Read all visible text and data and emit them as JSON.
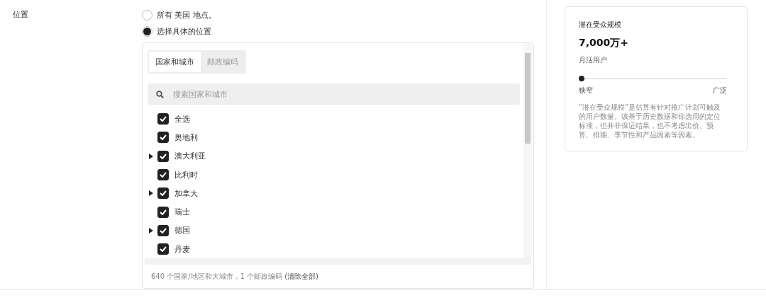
{
  "field_label": "位置",
  "options": [
    {
      "label": "所有 美国 地点。",
      "selected": false
    },
    {
      "label": "选择具体的位置",
      "selected": true
    }
  ],
  "tabs": [
    {
      "label": "国家和城市",
      "selected": true
    },
    {
      "label": "邮政编码",
      "selected": false
    }
  ],
  "search": {
    "placeholder": "搜索国家和城市"
  },
  "items": [
    {
      "label": "全选",
      "checked": true,
      "expandable": false
    },
    {
      "label": "奥地利",
      "checked": true,
      "expandable": false
    },
    {
      "label": "澳大利亚",
      "checked": true,
      "expandable": true
    },
    {
      "label": "比利时",
      "checked": true,
      "expandable": false
    },
    {
      "label": "加拿大",
      "checked": true,
      "expandable": true
    },
    {
      "label": "瑞士",
      "checked": true,
      "expandable": false
    },
    {
      "label": "德国",
      "checked": true,
      "expandable": true
    },
    {
      "label": "丹麦",
      "checked": true,
      "expandable": false
    }
  ],
  "summary": {
    "text": "640 个国家/地区和大城市，1 个邮政编码",
    "link": "(清除全部)"
  },
  "audience": {
    "title": "潜在受众规模",
    "value": "7,000万+",
    "unit": "月活用户",
    "level": 0,
    "min_label": "狭窄",
    "max_label": "广泛",
    "note": "“潜在受众规模”是估算有针对推广计划可触及的用户数量。该基于历史数据和你选用的定位标准，但并非保证结果，也不考虑出价、预算、排期、季节性和产品因素等因素。"
  }
}
